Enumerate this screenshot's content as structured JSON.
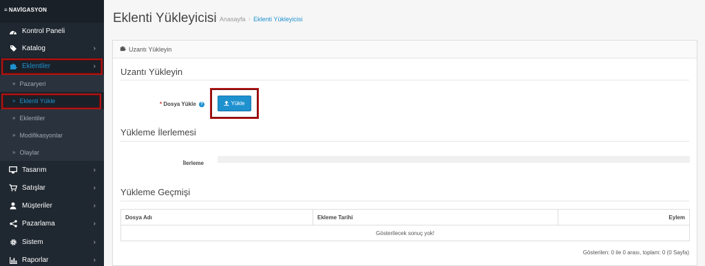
{
  "sidebar": {
    "header": "NAVİGASYON",
    "items": [
      {
        "label": "Kontrol Paneli",
        "icon": "dashboard-icon",
        "has_children": false
      },
      {
        "label": "Katalog",
        "icon": "tags-icon",
        "has_children": true
      },
      {
        "label": "Eklentiler",
        "icon": "puzzle-icon",
        "has_children": true,
        "active": true
      },
      {
        "label": "Tasarım",
        "icon": "monitor-icon",
        "has_children": true
      },
      {
        "label": "Satışlar",
        "icon": "cart-icon",
        "has_children": true
      },
      {
        "label": "Müşteriler",
        "icon": "user-icon",
        "has_children": true
      },
      {
        "label": "Pazarlama",
        "icon": "share-icon",
        "has_children": true
      },
      {
        "label": "Sistem",
        "icon": "cog-icon",
        "has_children": true
      },
      {
        "label": "Raporlar",
        "icon": "bar-chart-icon",
        "has_children": true
      }
    ],
    "subitems": [
      {
        "label": "Pazaryeri"
      },
      {
        "label": "Eklenti Yükle",
        "current": true
      },
      {
        "label": "Eklentiler"
      },
      {
        "label": "Modifikasyonlar"
      },
      {
        "label": "Olaylar"
      }
    ],
    "chevron": "›",
    "bullet": "»"
  },
  "page": {
    "title": "Eklenti Yükleyicisi",
    "breadcrumb": [
      "Anasayfa",
      "Eklenti Yükleyicisi"
    ],
    "breadcrumb_sep": "›"
  },
  "panel": {
    "heading": "Uzantı Yükleyin",
    "section_upload": "Uzantı Yükleyin",
    "file_label": "Dosya Yükle",
    "required_mark": "*",
    "help_mark": "?",
    "upload_button": "Yükle",
    "section_progress": "Yükleme İlerlemesi",
    "progress_label": "İlerleme",
    "progress_value": 0,
    "section_history": "Yükleme Geçmişi",
    "table": {
      "columns": [
        "Dosya Adı",
        "Ekleme Tarihi",
        "Eylem"
      ],
      "empty_text": "Gösterilecek sonuç yok!"
    },
    "pagination_info": "Gösterilen: 0 ile 0 arası, toplam: 0 (0 Sayfa)"
  },
  "colors": {
    "accent": "#1e91cf",
    "sidebar_bg": "#1f2730",
    "highlight_box": "#b01414"
  }
}
